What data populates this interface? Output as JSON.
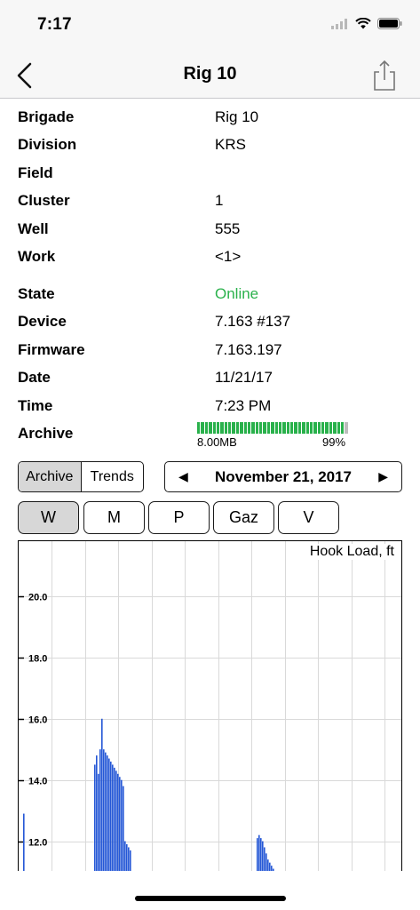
{
  "status_bar": {
    "time": "7:17"
  },
  "nav": {
    "title": "Rig 10"
  },
  "info": [
    {
      "label": "Brigade",
      "value": "Rig 10"
    },
    {
      "label": "Division",
      "value": "KRS"
    },
    {
      "label": "Field",
      "value": ""
    },
    {
      "label": "Cluster",
      "value": "1"
    },
    {
      "label": "Well",
      "value": "555"
    },
    {
      "label": "Work",
      "value": "<1>"
    },
    {
      "label": "State",
      "value": "Online"
    },
    {
      "label": "Device",
      "value": "7.163 #137"
    },
    {
      "label": "Firmware",
      "value": "7.163.197"
    },
    {
      "label": "Date",
      "value": "11/21/17"
    },
    {
      "label": "Time",
      "value": "7:23 PM"
    },
    {
      "label": "Archive",
      "value": ""
    }
  ],
  "archive": {
    "size": "8.00MB",
    "percent": "99%",
    "fill": 0.99
  },
  "mode_segment": {
    "archive": "Archive",
    "trends": "Trends",
    "selected": "Archive"
  },
  "date_nav": {
    "date": "November 21, 2017",
    "prev": "◀",
    "next": "▶"
  },
  "params": [
    "W",
    "M",
    "P",
    "Gaz",
    "V"
  ],
  "selected_param": "W",
  "colors": {
    "online": "#2bb24c",
    "archive_bar": "#29b14b",
    "series": "#2457d6"
  },
  "chart_data": {
    "type": "bar",
    "title": "Hook Load, ft",
    "y_ticks": [
      "12.0",
      "14.0",
      "16.0",
      "18.0",
      "20.0"
    ],
    "ylim": [
      11.0,
      21.8
    ],
    "bars": [
      {
        "group": 1,
        "values": [
          12.9
        ]
      },
      {
        "group": 2,
        "values": [
          14.5,
          14.8,
          14.2,
          15.0,
          16.0,
          15.0,
          14.9,
          14.8,
          14.7,
          14.6,
          14.5,
          14.4,
          14.3,
          14.2,
          14.1,
          14.0,
          13.8,
          12.0,
          11.9,
          11.8,
          11.7
        ]
      },
      {
        "group": 3,
        "values": [
          12.1,
          12.2,
          12.1,
          12.0,
          11.8,
          11.6,
          11.4,
          11.3,
          11.2,
          11.1
        ]
      }
    ]
  }
}
